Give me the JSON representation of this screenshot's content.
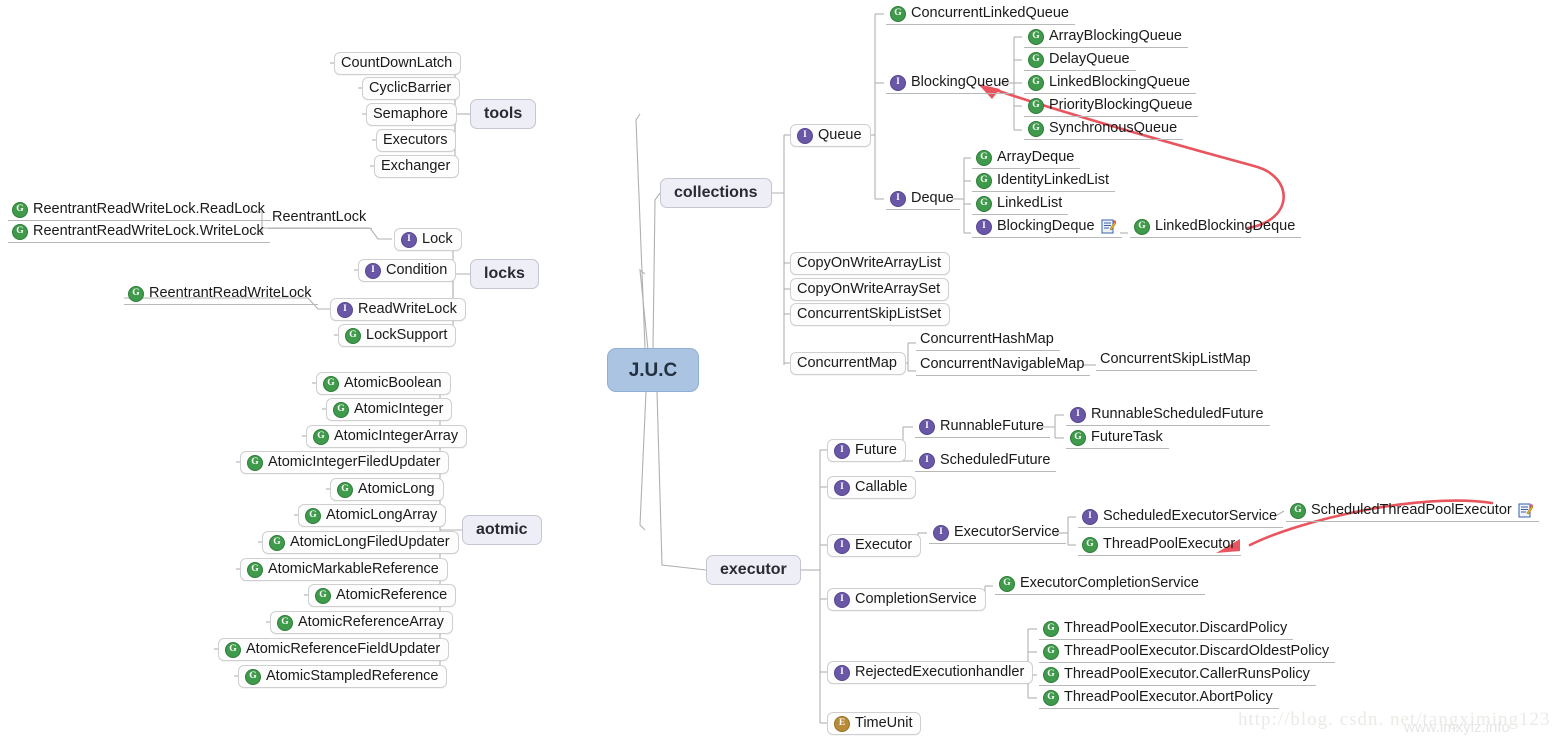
{
  "root": {
    "label": "J.U.C"
  },
  "branches": [
    {
      "id": "tools",
      "label": "tools"
    },
    {
      "id": "locks",
      "label": "locks"
    },
    {
      "id": "aotmic",
      "label": "aotmic"
    },
    {
      "id": "collections",
      "label": "collections"
    },
    {
      "id": "executor",
      "label": "executor"
    }
  ],
  "tools": {
    "items": [
      {
        "label": "CountDownLatch",
        "icon": "none",
        "style": "box"
      },
      {
        "label": "CyclicBarrier",
        "icon": "none",
        "style": "box"
      },
      {
        "label": "Semaphore",
        "icon": "none",
        "style": "box"
      },
      {
        "label": "Executors",
        "icon": "none",
        "style": "box"
      },
      {
        "label": "Exchanger",
        "icon": "none",
        "style": "box"
      }
    ]
  },
  "locks": {
    "items": [
      {
        "label": "Lock",
        "icon": "interface",
        "style": "box"
      },
      {
        "label": "Condition",
        "icon": "interface",
        "style": "box"
      },
      {
        "label": "ReadWriteLock",
        "icon": "interface",
        "style": "box"
      },
      {
        "label": "LockSupport",
        "icon": "class",
        "style": "box"
      }
    ],
    "lock_children": [
      {
        "label": "ReentrantLock",
        "icon": "none",
        "style": "plain"
      }
    ],
    "reentrantlock_children": [
      {
        "label": "ReentrantReadWriteLock.ReadLock",
        "icon": "class",
        "style": "plain"
      },
      {
        "label": "ReentrantReadWriteLock.WriteLock",
        "icon": "class",
        "style": "plain"
      }
    ],
    "readwritelock_children": [
      {
        "label": "ReentrantReadWriteLock",
        "icon": "class",
        "style": "plain"
      }
    ]
  },
  "aotmic": {
    "items": [
      {
        "label": "AtomicBoolean",
        "icon": "class",
        "style": "box"
      },
      {
        "label": "AtomicInteger",
        "icon": "class",
        "style": "box"
      },
      {
        "label": "AtomicIntegerArray",
        "icon": "class",
        "style": "box"
      },
      {
        "label": "AtomicIntegerFiledUpdater",
        "icon": "class",
        "style": "box"
      },
      {
        "label": "AtomicLong",
        "icon": "class",
        "style": "box"
      },
      {
        "label": "AtomicLongArray",
        "icon": "class",
        "style": "box"
      },
      {
        "label": "AtomicLongFiledUpdater",
        "icon": "class",
        "style": "box"
      },
      {
        "label": "AtomicMarkableReference",
        "icon": "class",
        "style": "box"
      },
      {
        "label": "AtomicReference",
        "icon": "class",
        "style": "box"
      },
      {
        "label": "AtomicReferenceArray",
        "icon": "class",
        "style": "box"
      },
      {
        "label": "AtomicReferenceFieldUpdater",
        "icon": "class",
        "style": "box"
      },
      {
        "label": "AtomicStampledReference",
        "icon": "class",
        "style": "box"
      }
    ]
  },
  "collections": {
    "items": [
      {
        "label": "Queue",
        "icon": "interface",
        "style": "box"
      },
      {
        "label": "CopyOnWriteArrayList",
        "icon": "none",
        "style": "box"
      },
      {
        "label": "CopyOnWriteArraySet",
        "icon": "none",
        "style": "box"
      },
      {
        "label": "ConcurrentSkipListSet",
        "icon": "none",
        "style": "box"
      },
      {
        "label": "ConcurrentMap",
        "icon": "none",
        "style": "box"
      }
    ],
    "queue_children": [
      {
        "label": "ConcurrentLinkedQueue",
        "icon": "class",
        "style": "plain"
      },
      {
        "label": "BlockingQueue",
        "icon": "interface",
        "style": "plain"
      },
      {
        "label": "Deque",
        "icon": "interface",
        "style": "plain"
      }
    ],
    "blockingqueue_children": [
      {
        "label": "ArrayBlockingQueue",
        "icon": "class",
        "style": "plain"
      },
      {
        "label": "DelayQueue",
        "icon": "class",
        "style": "plain"
      },
      {
        "label": "LinkedBlockingQueue",
        "icon": "class",
        "style": "plain"
      },
      {
        "label": "PriorityBlockingQueue",
        "icon": "class",
        "style": "plain"
      },
      {
        "label": "SynchronousQueue",
        "icon": "class",
        "style": "plain"
      }
    ],
    "deque_children": [
      {
        "label": "ArrayDeque",
        "icon": "class",
        "style": "plain"
      },
      {
        "label": "IdentityLinkedList",
        "icon": "class",
        "style": "plain"
      },
      {
        "label": "LinkedList",
        "icon": "class",
        "style": "plain"
      },
      {
        "label": "BlockingDeque",
        "icon": "interface",
        "style": "plain",
        "note": true
      }
    ],
    "blockingdeque_children": [
      {
        "label": "LinkedBlockingDeque",
        "icon": "class",
        "style": "plain"
      }
    ],
    "concurrentmap_children": [
      {
        "label": "ConcurrentHashMap",
        "icon": "none",
        "style": "plain"
      },
      {
        "label": "ConcurrentNavigableMap",
        "icon": "none",
        "style": "plain"
      }
    ],
    "concurrentnavigablemap_children": [
      {
        "label": "ConcurrentSkipListMap",
        "icon": "none",
        "style": "plain"
      }
    ]
  },
  "executor": {
    "items": [
      {
        "label": "Future",
        "icon": "interface",
        "style": "box"
      },
      {
        "label": "Callable",
        "icon": "interface",
        "style": "box"
      },
      {
        "label": "Executor",
        "icon": "interface",
        "style": "box"
      },
      {
        "label": "CompletionService",
        "icon": "interface",
        "style": "box"
      },
      {
        "label": "RejectedExecutionhandler",
        "icon": "interface",
        "style": "box"
      },
      {
        "label": "TimeUnit",
        "icon": "enum",
        "style": "box"
      }
    ],
    "future_children": [
      {
        "label": "RunnableFuture",
        "icon": "interface",
        "style": "plain"
      },
      {
        "label": "ScheduledFuture",
        "icon": "interface",
        "style": "plain"
      }
    ],
    "runnablefuture_children": [
      {
        "label": "RunnableScheduledFuture",
        "icon": "interface",
        "style": "plain"
      },
      {
        "label": "FutureTask",
        "icon": "class",
        "style": "plain"
      }
    ],
    "executor_children": [
      {
        "label": "ExecutorService",
        "icon": "interface",
        "style": "plain"
      }
    ],
    "executorservice_children": [
      {
        "label": "ScheduledExecutorService",
        "icon": "interface",
        "style": "plain"
      },
      {
        "label": "ThreadPoolExecutor",
        "icon": "class",
        "style": "plain"
      }
    ],
    "scheduledexecutorservice_children": [
      {
        "label": "ScheduledThreadPoolExecutor",
        "icon": "class",
        "style": "plain",
        "note": true
      }
    ],
    "completionservice_children": [
      {
        "label": "ExecutorCompletionService",
        "icon": "class",
        "style": "plain"
      }
    ],
    "rejectedhandler_children": [
      {
        "label": "ThreadPoolExecutor.DiscardPolicy",
        "icon": "class",
        "style": "plain"
      },
      {
        "label": "ThreadPoolExecutor.DiscardOldestPolicy",
        "icon": "class",
        "style": "plain"
      },
      {
        "label": "ThreadPoolExecutor.CallerRunsPolicy",
        "icon": "class",
        "style": "plain"
      },
      {
        "label": "ThreadPoolExecutor.AbortPolicy",
        "icon": "class",
        "style": "plain"
      }
    ]
  },
  "annotations": {
    "arrows": [
      {
        "from": "LinkedBlockingDeque",
        "to": "BlockingQueue",
        "color": "#e8555f"
      },
      {
        "from": "ScheduledThreadPoolExecutor",
        "to": "ThreadPoolExecutor",
        "color": "#e8555f"
      }
    ]
  },
  "watermarks": {
    "primary": "http://blog. csdn. net/tangximing123",
    "secondary": "www.imxylz.info"
  }
}
